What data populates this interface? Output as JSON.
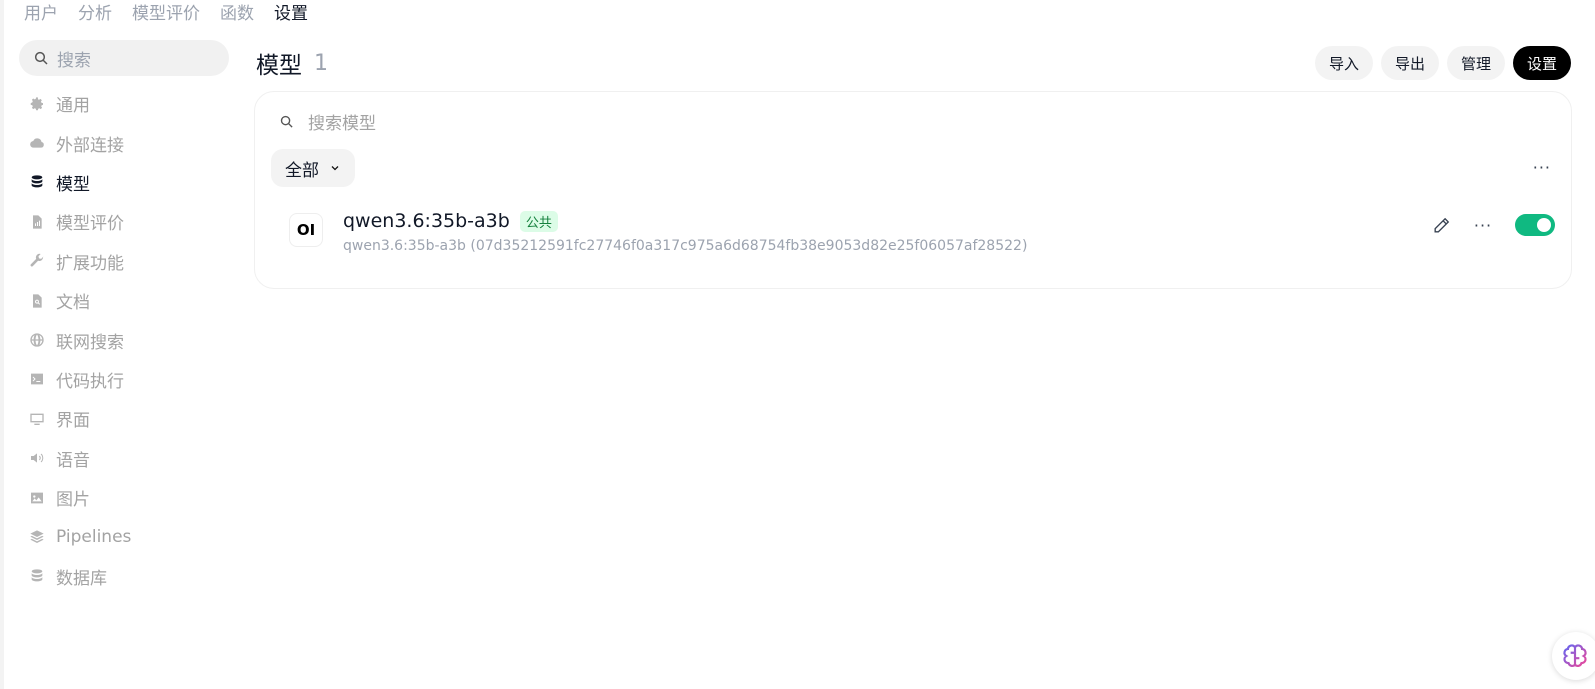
{
  "topnav": {
    "items": [
      "用户",
      "分析",
      "模型评价",
      "函数",
      "设置"
    ],
    "active": "设置"
  },
  "sidebar": {
    "search_placeholder": "搜索",
    "items": [
      {
        "label": "通用",
        "icon": "gear-icon",
        "active": false
      },
      {
        "label": "外部连接",
        "icon": "cloud-icon",
        "active": false
      },
      {
        "label": "模型",
        "icon": "database-icon",
        "active": true
      },
      {
        "label": "模型评价",
        "icon": "chart-document-icon",
        "active": false
      },
      {
        "label": "扩展功能",
        "icon": "wrench-icon",
        "active": false
      },
      {
        "label": "文档",
        "icon": "document-search-icon",
        "active": false
      },
      {
        "label": "联网搜索",
        "icon": "globe-icon",
        "active": false
      },
      {
        "label": "代码执行",
        "icon": "terminal-icon",
        "active": false
      },
      {
        "label": "界面",
        "icon": "monitor-icon",
        "active": false
      },
      {
        "label": "语音",
        "icon": "speaker-icon",
        "active": false
      },
      {
        "label": "图片",
        "icon": "image-icon",
        "active": false
      },
      {
        "label": "Pipelines",
        "icon": "layers-icon",
        "active": false
      },
      {
        "label": "数据库",
        "icon": "database-icon",
        "active": false
      }
    ]
  },
  "header": {
    "title": "模型",
    "count": "1",
    "actions": {
      "import": "导入",
      "export": "导出",
      "manage": "管理",
      "settings": "设置"
    }
  },
  "card": {
    "search_placeholder": "搜索模型",
    "filter_label": "全部",
    "more": "···"
  },
  "models": [
    {
      "logo": "OI",
      "name": "qwen3.6:35b-a3b",
      "badge": "公共",
      "subtitle": "qwen3.6:35b-a3b (07d35212591fc27746f0a317c975a6d68754fb38e9053d82e25f06057af28522)",
      "more": "···",
      "enabled": true
    }
  ],
  "colors": {
    "toggle_on": "#10b981",
    "badge_bg": "#dcfce7",
    "badge_text": "#15803d",
    "primary_button": "#000000"
  }
}
